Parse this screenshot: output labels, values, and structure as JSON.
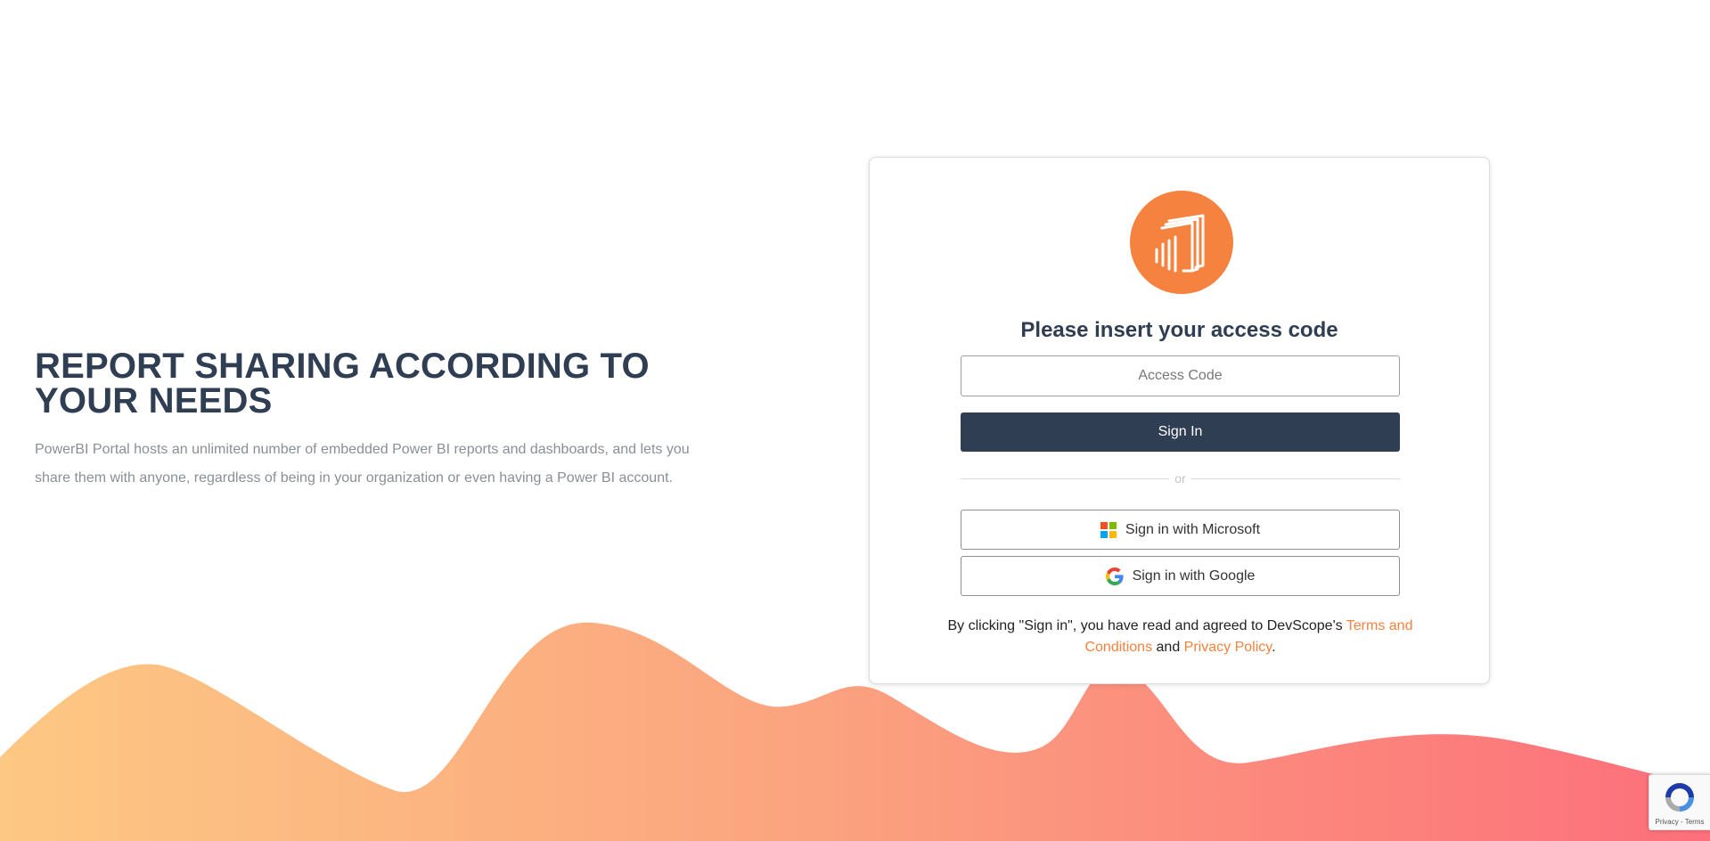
{
  "hero": {
    "title": "REPORT SHARING ACCORDING TO YOUR NEEDS",
    "description": "PowerBI Portal hosts an unlimited number of embedded Power BI reports and dashboards, and lets you share them with anyone, regardless of being in your organization or even having a Power BI account."
  },
  "login": {
    "logo_icon": "power-bi-report-icon",
    "title": "Please insert your access code",
    "access_code_placeholder": "Access Code",
    "access_code_value": "",
    "sign_in_label": "Sign In",
    "divider_text": "or",
    "microsoft_label": "Sign in with Microsoft",
    "google_label": "Sign in with Google",
    "terms_prefix": "By clicking \"Sign in\", you have read and agreed to DevScope's ",
    "terms_link": "Terms and Conditions",
    "terms_middle": " and ",
    "privacy_link": "Privacy Policy",
    "terms_suffix": "."
  },
  "recaptcha": {
    "links": "Privacy - Terms"
  },
  "colors": {
    "accent_orange": "#f5823f",
    "navy": "#2f3e52",
    "wave_start": "#fdc883",
    "wave_end": "#fc6f7b"
  }
}
